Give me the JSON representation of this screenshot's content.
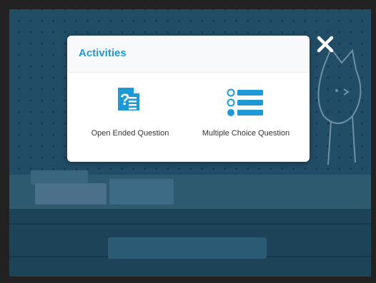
{
  "modal": {
    "title": "Activities",
    "items": [
      {
        "label": "Open Ended Question",
        "icon": "open-ended-question-icon"
      },
      {
        "label": "Multiple Choice Question",
        "icon": "multiple-choice-list-icon"
      }
    ]
  },
  "close": {
    "icon": "close-icon"
  },
  "colors": {
    "accent": "#1d9ad6",
    "backdrop": "#1f4c66",
    "modal_bg": "#ffffff"
  }
}
